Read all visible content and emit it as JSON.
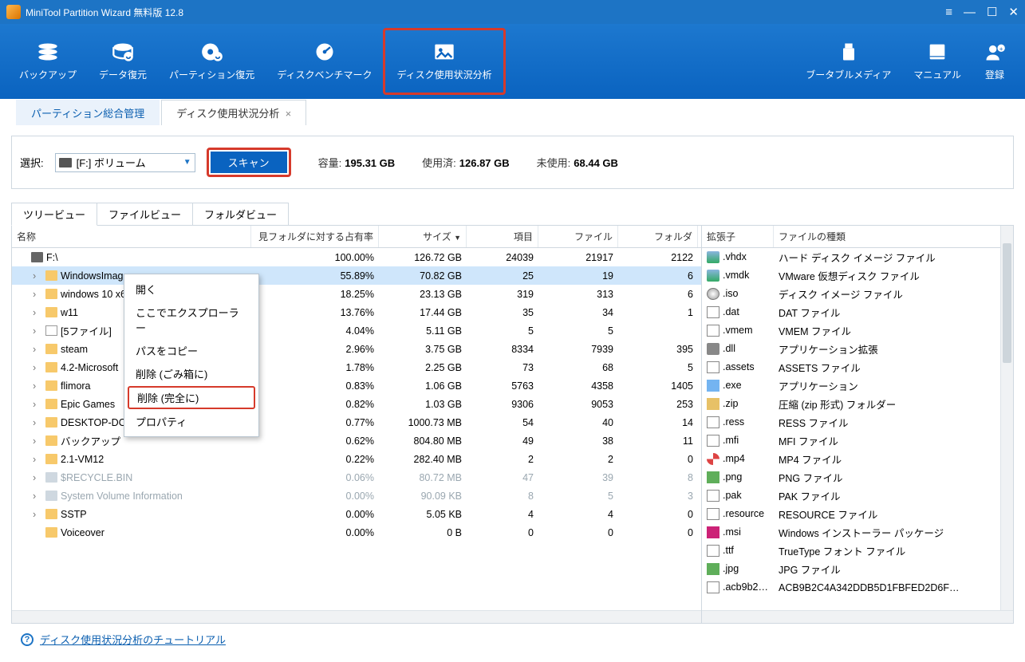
{
  "window": {
    "title": "MiniTool Partition Wizard 無料版  12.8"
  },
  "toolbar": {
    "backup": "バックアップ",
    "data_recovery": "データ復元",
    "partition_recovery": "パーティション復元",
    "disk_benchmark": "ディスクベンチマーク",
    "disk_usage": "ディスク使用状況分析",
    "bootable_media": "ブータブルメディア",
    "manual": "マニュアル",
    "register": "登録"
  },
  "page_tabs": {
    "partition_mgmt": "パーティション総合管理",
    "disk_usage": "ディスク使用状況分析"
  },
  "scan_bar": {
    "select_label": "選択:",
    "volume": "[F:] ボリューム",
    "scan_btn": "スキャン",
    "capacity_label": "容量:",
    "capacity_value": "195.31 GB",
    "used_label": "使用済:",
    "used_value": "126.87 GB",
    "unused_label": "未使用:",
    "unused_value": "68.44 GB"
  },
  "view_tabs": {
    "tree": "ツリービュー",
    "file": "ファイルビュー",
    "folder": "フォルダビュー"
  },
  "tree_headers": {
    "name": "名称",
    "occupancy": "見フォルダに対する占有率",
    "size": "サイズ",
    "items": "項目",
    "files": "ファイル",
    "folders": "フォルダ"
  },
  "tree_rows": [
    {
      "name": "F:\\",
      "icon": "drive",
      "depth": 0,
      "exp": false,
      "occ": "100.00%",
      "size": "126.72 GB",
      "items": "24039",
      "files": "21917",
      "folders": "2122"
    },
    {
      "name": "WindowsImag…",
      "icon": "folder",
      "depth": 1,
      "exp": true,
      "occ": "55.89%",
      "size": "70.82 GB",
      "items": "25",
      "files": "19",
      "folders": "6",
      "selected": true
    },
    {
      "name": "windows 10 x6…",
      "icon": "folder",
      "depth": 1,
      "exp": true,
      "occ": "18.25%",
      "size": "23.13 GB",
      "items": "319",
      "files": "313",
      "folders": "6"
    },
    {
      "name": "w11",
      "icon": "folder",
      "depth": 1,
      "exp": true,
      "occ": "13.76%",
      "size": "17.44 GB",
      "items": "35",
      "files": "34",
      "folders": "1"
    },
    {
      "name": "[5ファイル]",
      "icon": "file",
      "depth": 1,
      "exp": true,
      "occ": "4.04%",
      "size": "5.11 GB",
      "items": "5",
      "files": "5",
      "folders": ""
    },
    {
      "name": "steam",
      "icon": "folder",
      "depth": 1,
      "exp": true,
      "occ": "2.96%",
      "size": "3.75 GB",
      "items": "8334",
      "files": "7939",
      "folders": "395"
    },
    {
      "name": "4.2-Microsoft",
      "icon": "folder",
      "depth": 1,
      "exp": true,
      "occ": "1.78%",
      "size": "2.25 GB",
      "items": "73",
      "files": "68",
      "folders": "5"
    },
    {
      "name": "flimora",
      "icon": "folder",
      "depth": 1,
      "exp": true,
      "occ": "0.83%",
      "size": "1.06 GB",
      "items": "5763",
      "files": "4358",
      "folders": "1405"
    },
    {
      "name": "Epic Games",
      "icon": "folder",
      "depth": 1,
      "exp": true,
      "occ": "0.82%",
      "size": "1.03 GB",
      "items": "9306",
      "files": "9053",
      "folders": "253"
    },
    {
      "name": "DESKTOP-DO…",
      "icon": "folder",
      "depth": 1,
      "exp": true,
      "occ": "0.77%",
      "size": "1000.73 MB",
      "items": "54",
      "files": "40",
      "folders": "14"
    },
    {
      "name": "バックアップ",
      "icon": "folder",
      "depth": 1,
      "exp": true,
      "occ": "0.62%",
      "size": "804.80 MB",
      "items": "49",
      "files": "38",
      "folders": "11"
    },
    {
      "name": "2.1-VM12",
      "icon": "folder",
      "depth": 1,
      "exp": true,
      "occ": "0.22%",
      "size": "282.40 MB",
      "items": "2",
      "files": "2",
      "folders": "0"
    },
    {
      "name": "$RECYCLE.BIN",
      "icon": "hidden-folder",
      "depth": 1,
      "exp": true,
      "occ": "0.06%",
      "size": "80.72 MB",
      "items": "47",
      "files": "39",
      "folders": "8",
      "dim": true
    },
    {
      "name": "System Volume Information",
      "icon": "hidden-folder",
      "depth": 1,
      "exp": true,
      "occ": "0.00%",
      "size": "90.09 KB",
      "items": "8",
      "files": "5",
      "folders": "3",
      "dim": true
    },
    {
      "name": "SSTP",
      "icon": "folder",
      "depth": 1,
      "exp": true,
      "occ": "0.00%",
      "size": "5.05 KB",
      "items": "4",
      "files": "4",
      "folders": "0"
    },
    {
      "name": "Voiceover",
      "icon": "folder",
      "depth": 1,
      "exp": false,
      "occ": "0.00%",
      "size": "0 B",
      "items": "0",
      "files": "0",
      "folders": "0"
    }
  ],
  "ext_headers": {
    "ext": "拡張子",
    "type": "ファイルの種類"
  },
  "ext_rows": [
    {
      "ext": ".vhdx",
      "type": "ハード ディスク イメージ ファイル",
      "icon": "disk"
    },
    {
      "ext": ".vmdk",
      "type": "VMware 仮想ディスク ファイル",
      "icon": "disk"
    },
    {
      "ext": ".iso",
      "type": "ディスク イメージ ファイル",
      "icon": "cd"
    },
    {
      "ext": ".dat",
      "type": "DAT ファイル",
      "icon": "doc"
    },
    {
      "ext": ".vmem",
      "type": "VMEM ファイル",
      "icon": "doc"
    },
    {
      "ext": ".dll",
      "type": "アプリケーション拡張",
      "icon": "gear"
    },
    {
      "ext": ".assets",
      "type": "ASSETS ファイル",
      "icon": "doc"
    },
    {
      "ext": ".exe",
      "type": "アプリケーション",
      "icon": "exe"
    },
    {
      "ext": ".zip",
      "type": "圧縮 (zip 形式) フォルダー",
      "icon": "zip"
    },
    {
      "ext": ".ress",
      "type": "RESS ファイル",
      "icon": "doc"
    },
    {
      "ext": ".mfi",
      "type": "MFI ファイル",
      "icon": "doc"
    },
    {
      "ext": ".mp4",
      "type": "MP4 ファイル",
      "icon": "mp4"
    },
    {
      "ext": ".png",
      "type": "PNG ファイル",
      "icon": "img"
    },
    {
      "ext": ".pak",
      "type": "PAK ファイル",
      "icon": "doc"
    },
    {
      "ext": ".resource",
      "type": "RESOURCE ファイル",
      "icon": "doc"
    },
    {
      "ext": ".msi",
      "type": "Windows インストーラー パッケージ",
      "icon": "msi"
    },
    {
      "ext": ".ttf",
      "type": "TrueType フォント ファイル",
      "icon": "doc"
    },
    {
      "ext": ".jpg",
      "type": "JPG ファイル",
      "icon": "img"
    },
    {
      "ext": ".acb9b2c4…",
      "type": "ACB9B2C4A342DDB5D1FBFED2D6F…",
      "icon": "doc"
    }
  ],
  "context_menu": {
    "open": "開く",
    "open_explorer": "ここでエクスプローラー",
    "copy_path": "パスをコピー",
    "delete_recycle": "削除 (ごみ箱に)",
    "delete_perm": "削除 (完全に)",
    "properties": "プロパティ"
  },
  "footer": {
    "tutorial_link": "ディスク使用状況分析のチュートリアル"
  }
}
